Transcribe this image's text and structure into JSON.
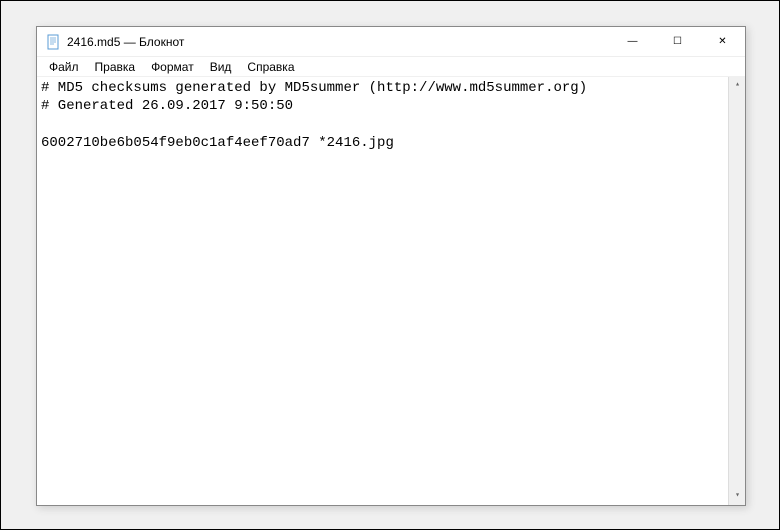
{
  "window": {
    "title": "2416.md5 — Блокнот"
  },
  "menu": {
    "file": "Файл",
    "edit": "Правка",
    "format": "Формат",
    "view": "Вид",
    "help": "Справка"
  },
  "content": {
    "line1": "# MD5 checksums generated by MD5summer (http://www.md5summer.org)",
    "line2": "# Generated 26.09.2017 9:50:50",
    "line3": "",
    "line4": "6002710be6b054f9eb0c1af4eef70ad7 *2416.jpg"
  },
  "controls": {
    "minimize": "—",
    "maximize": "☐",
    "close": "✕"
  },
  "scroll": {
    "up": "▴",
    "down": "▾"
  }
}
